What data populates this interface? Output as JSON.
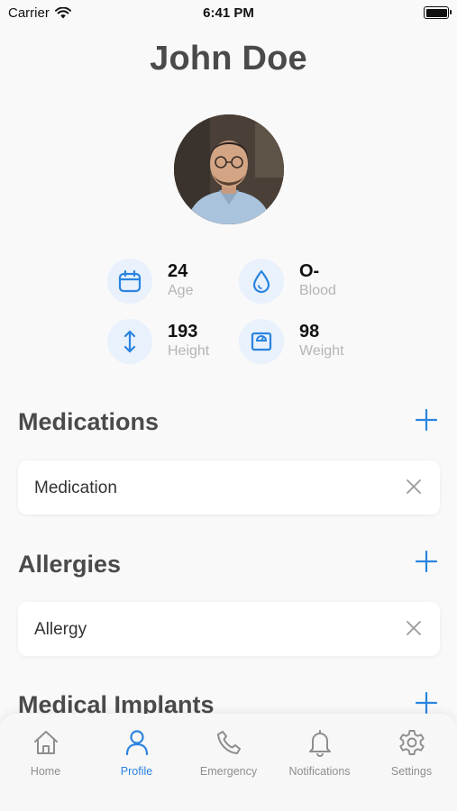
{
  "status_bar": {
    "carrier": "Carrier",
    "time": "6:41 PM"
  },
  "profile": {
    "name": "John Doe"
  },
  "stats": {
    "age": {
      "value": "24",
      "label": "Age"
    },
    "blood": {
      "value": "O-",
      "label": "Blood"
    },
    "height": {
      "value": "193",
      "label": "Height"
    },
    "weight": {
      "value": "98",
      "label": "Weight"
    }
  },
  "sections": {
    "medications": {
      "title": "Medications",
      "item": "Medication"
    },
    "allergies": {
      "title": "Allergies",
      "item": "Allergy"
    },
    "implants": {
      "title": "Medical Implants"
    }
  },
  "tabs": [
    {
      "label": "Home",
      "icon": "home-icon"
    },
    {
      "label": "Profile",
      "icon": "person-icon"
    },
    {
      "label": "Emergency",
      "icon": "phone-icon"
    },
    {
      "label": "Notifications",
      "icon": "bell-icon"
    },
    {
      "label": "Settings",
      "icon": "gear-icon"
    }
  ],
  "colors": {
    "accent": "#2b84e0",
    "icon_bg": "#e8f1fc",
    "tab_inactive": "#8e8e8e"
  }
}
